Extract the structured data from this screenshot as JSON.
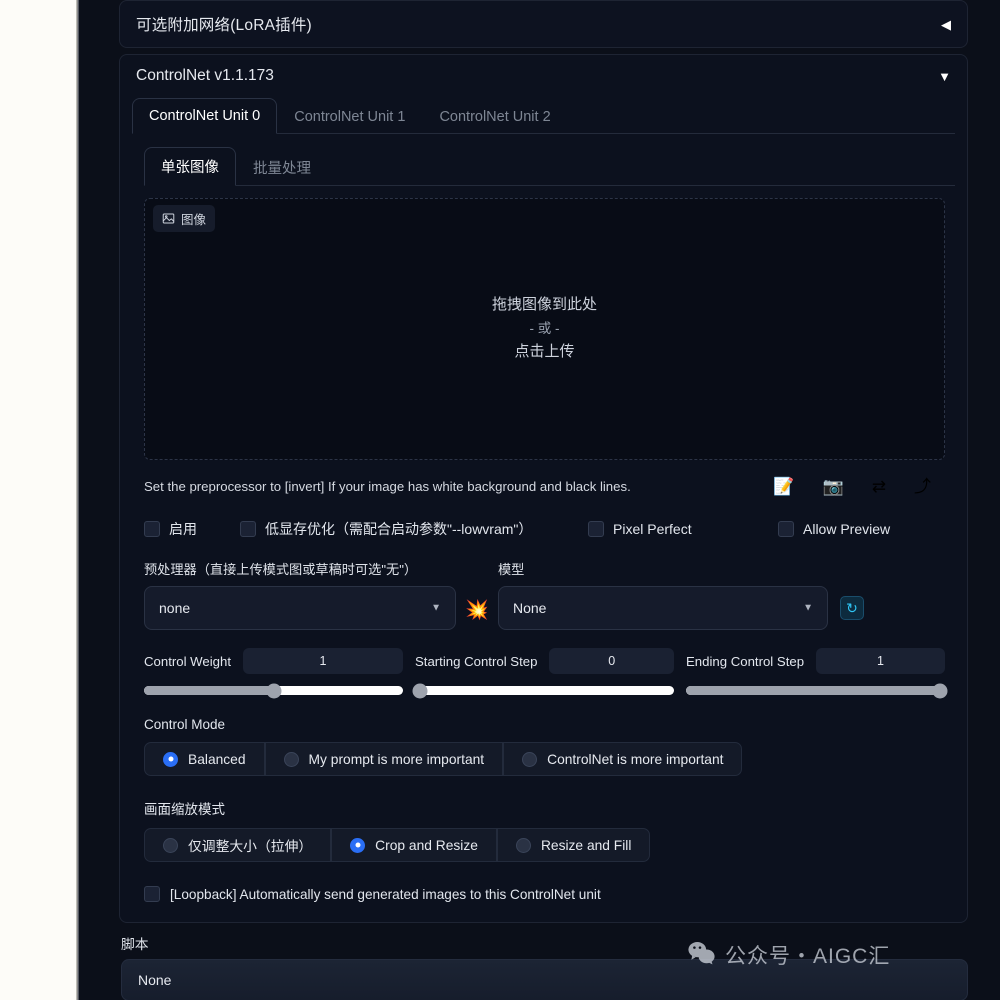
{
  "lora_panel": {
    "title": "可选附加网络(LoRA插件)",
    "toggle_icon": "triangle-left-icon",
    "toggle_glyph": "◀"
  },
  "controlnet_panel": {
    "title": "ControlNet v1.1.173",
    "toggle_icon": "triangle-down-icon",
    "toggle_glyph": "▼",
    "unit_tabs": [
      {
        "label": "ControlNet Unit 0",
        "active": true
      },
      {
        "label": "ControlNet Unit 1",
        "active": false
      },
      {
        "label": "ControlNet Unit 2",
        "active": false
      }
    ],
    "inner_tabs": [
      {
        "label": "单张图像",
        "active": true
      },
      {
        "label": "批量处理",
        "active": false
      }
    ],
    "dropzone": {
      "badge_label": "图像",
      "badge_icon": "image-icon",
      "line1": "拖拽图像到此处",
      "line2": "- 或 -",
      "line3": "点击上传"
    },
    "hint": {
      "text": "Set the preprocessor to [invert] If your image has white background and black lines.",
      "icons": [
        {
          "name": "edit-document-icon",
          "glyph": "📝"
        },
        {
          "name": "camera-icon",
          "glyph": "📷"
        },
        {
          "name": "swap-arrows-icon",
          "glyph": "⇄"
        },
        {
          "name": "send-arrow-icon",
          "glyph": "⤴"
        }
      ]
    },
    "checkboxes": [
      {
        "label": "启用",
        "checked": false
      },
      {
        "label": "低显存优化（需配合启动参数\"--lowvram\"）",
        "checked": false
      },
      {
        "label": "Pixel Perfect",
        "checked": false
      },
      {
        "label": "Allow Preview",
        "checked": false
      }
    ],
    "preprocessor": {
      "label": "预处理器（直接上传模式图或草稿时可选\"无\"）",
      "value": "none",
      "caret_icon": "chevron-down-icon"
    },
    "run_preprocessor_icon": {
      "name": "spark-icon",
      "glyph": "💥"
    },
    "model": {
      "label": "模型",
      "value": "None",
      "caret_icon": "chevron-down-icon"
    },
    "refresh_button": {
      "name": "refresh-icon",
      "glyph": "↻"
    },
    "sliders": [
      {
        "label": "Control Weight",
        "value": "1",
        "fill_pct": 50
      },
      {
        "label": "Starting Control Step",
        "value": "0",
        "fill_pct": 2
      },
      {
        "label": "Ending Control Step",
        "value": "1",
        "fill_pct": 98
      }
    ],
    "control_mode": {
      "label": "Control Mode",
      "options": [
        {
          "label": "Balanced",
          "selected": true
        },
        {
          "label": "My prompt is more important",
          "selected": false
        },
        {
          "label": "ControlNet is more important",
          "selected": false
        }
      ]
    },
    "resize_mode": {
      "label": "画面缩放模式",
      "options": [
        {
          "label": "仅调整大小（拉伸）",
          "selected": false
        },
        {
          "label": "Crop and Resize",
          "selected": true
        },
        {
          "label": "Resize and Fill",
          "selected": false
        }
      ]
    },
    "loopback": {
      "label": "[Loopback] Automatically send generated images to this ControlNet unit",
      "checked": false
    }
  },
  "script_section": {
    "label": "脚本",
    "value": "None",
    "caret_icon": "chevron-down-icon"
  },
  "watermark": {
    "icon": "wechat-icon",
    "text": "公众号・AIGC汇"
  },
  "colors": {
    "page_background": "#0b0f19",
    "panel_background": "#0c111e",
    "accent_blue": "#2a6ef5",
    "refresh_cyan": "#2fc6f5",
    "slider_track": "#ffffff",
    "slider_fill": "#9ea3ad",
    "text_primary": "#e6e9ef",
    "text_muted": "#7e8694"
  }
}
